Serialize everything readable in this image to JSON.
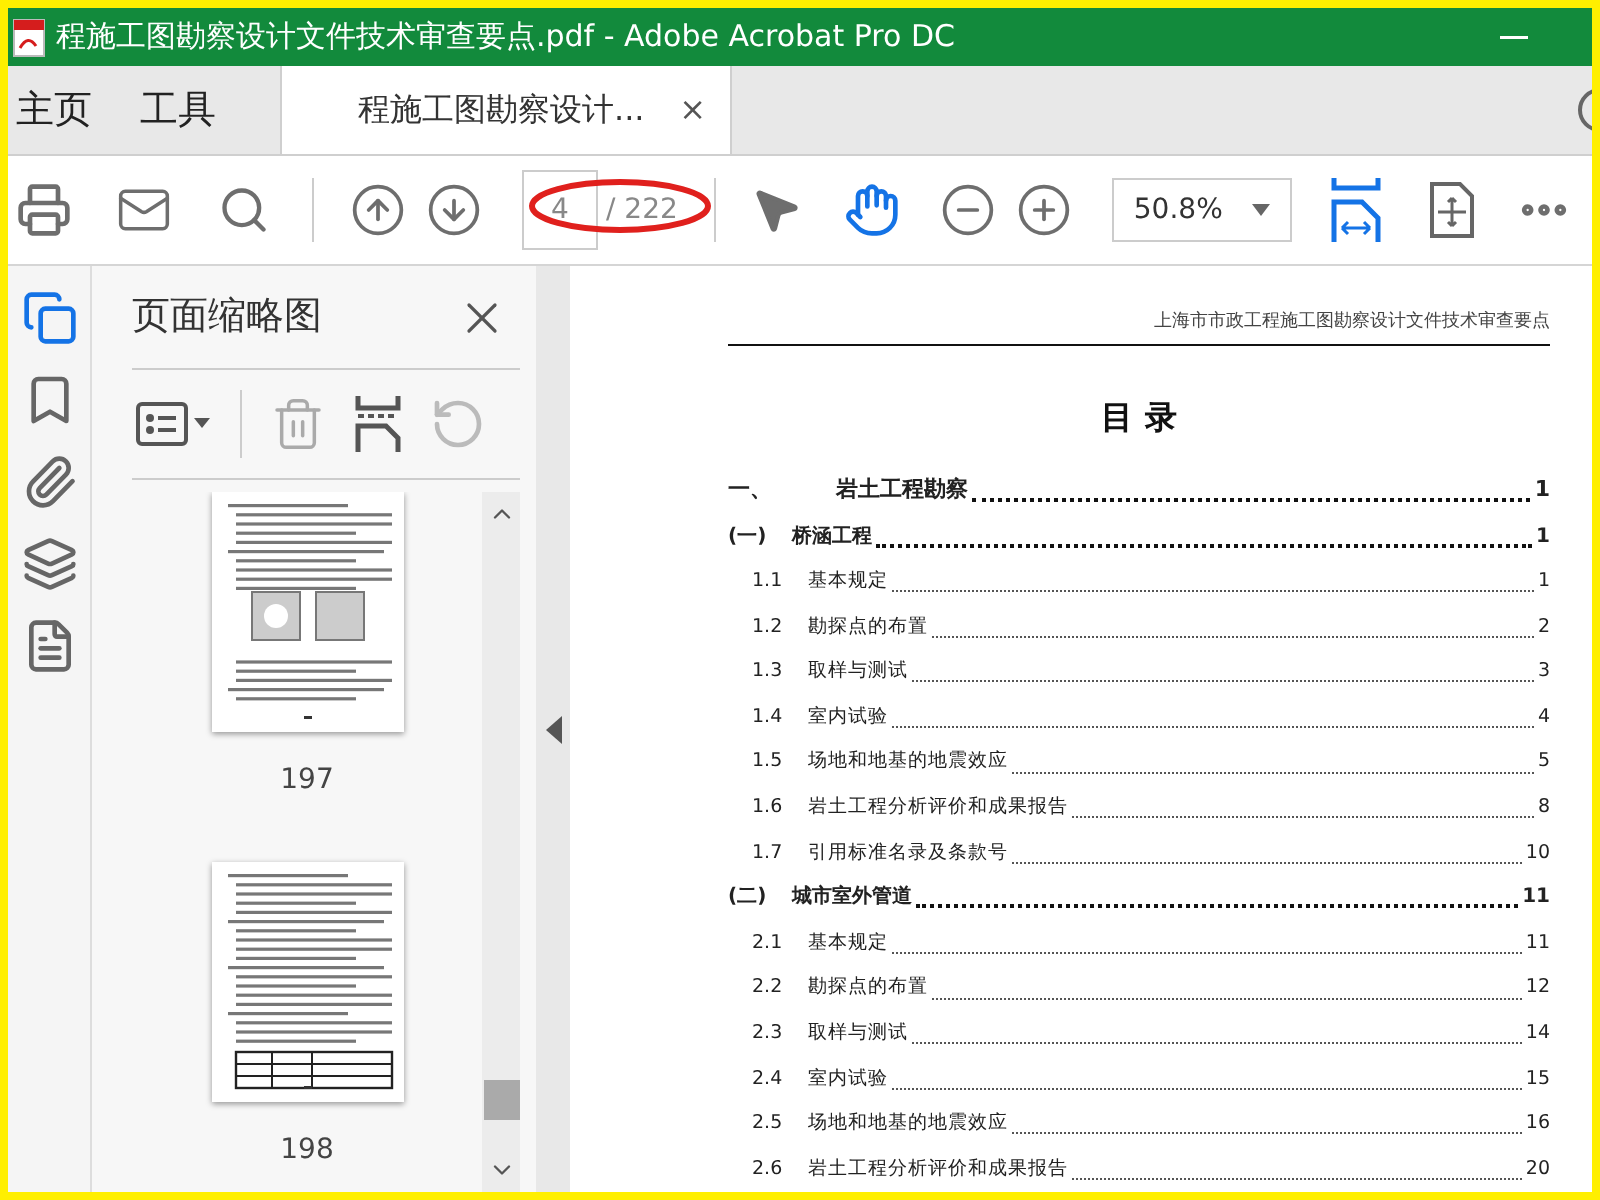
{
  "window": {
    "title": "程施工图勘察设计文件技术审查要点.pdf - Adobe Acrobat Pro DC"
  },
  "tabs": [
    {
      "label": "主页",
      "selected": false
    },
    {
      "label": "工具",
      "selected": false
    },
    {
      "label": "程施工图勘察设计...",
      "selected": true,
      "close": "×"
    }
  ],
  "toolbar": {
    "page_current": "4",
    "page_total": "/ 222",
    "zoom": "50.8%"
  },
  "sidebar": {
    "title": "页面缩略图",
    "thumbnails": [
      {
        "label": "197",
        "kind": "figures"
      },
      {
        "label": "198",
        "kind": "table"
      }
    ]
  },
  "document": {
    "header": "上海市市政工程施工图勘察设计文件技术审查要点",
    "title": "目 录",
    "toc": [
      {
        "kind": "chapter",
        "number": "一、",
        "title": "岩土工程勘察",
        "page": "1"
      },
      {
        "kind": "section",
        "number": "(一)",
        "title": "桥涵工程",
        "page": "1"
      },
      {
        "kind": "item",
        "number": "1.1",
        "title": "基本规定",
        "page": "1"
      },
      {
        "kind": "item",
        "number": "1.2",
        "title": "勘探点的布置",
        "page": "2"
      },
      {
        "kind": "item",
        "number": "1.3",
        "title": "取样与测试",
        "page": "3"
      },
      {
        "kind": "item",
        "number": "1.4",
        "title": "室内试验",
        "page": "4"
      },
      {
        "kind": "item",
        "number": "1.5",
        "title": "场地和地基的地震效应",
        "page": "5"
      },
      {
        "kind": "item",
        "number": "1.6",
        "title": "岩土工程分析评价和成果报告",
        "page": "8"
      },
      {
        "kind": "item",
        "number": "1.7",
        "title": "引用标准名录及条款号",
        "page": "10"
      },
      {
        "kind": "section",
        "number": "(二)",
        "title": "城市室外管道",
        "page": "11"
      },
      {
        "kind": "item",
        "number": "2.1",
        "title": "基本规定",
        "page": "11"
      },
      {
        "kind": "item",
        "number": "2.2",
        "title": "勘探点的布置",
        "page": "12"
      },
      {
        "kind": "item",
        "number": "2.3",
        "title": "取样与测试",
        "page": "14"
      },
      {
        "kind": "item",
        "number": "2.4",
        "title": "室内试验",
        "page": "15"
      },
      {
        "kind": "item",
        "number": "2.5",
        "title": "场地和地基的地震效应",
        "page": "16"
      },
      {
        "kind": "item",
        "number": "2.6",
        "title": "岩土工程分析评价和成果报告",
        "page": "20"
      }
    ]
  }
}
